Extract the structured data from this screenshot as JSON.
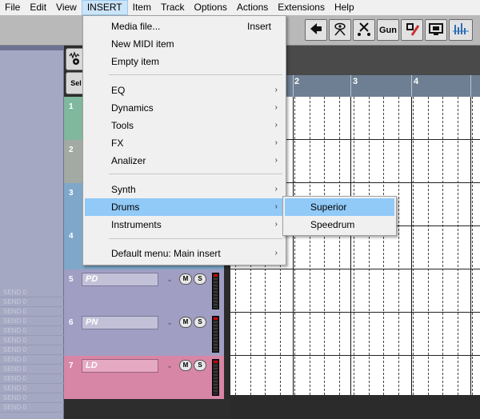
{
  "menubar": {
    "items": [
      "File",
      "Edit",
      "View",
      "INSERT",
      "Item",
      "Track",
      "Options",
      "Actions",
      "Extensions",
      "Help"
    ],
    "active": "INSERT"
  },
  "toolbar": {
    "buttons": [
      {
        "icon": "arrow-left-icon"
      },
      {
        "icon": "eye-icon"
      },
      {
        "icon": "nodes-icon"
      },
      {
        "label": "Gun"
      },
      {
        "icon": "brush-icon"
      },
      {
        "icon": "tape-icon"
      },
      {
        "icon": "meter-icon"
      }
    ],
    "select_label": "Sel"
  },
  "insert_menu": {
    "media_file": "Media file...",
    "media_file_shortcut": "Insert",
    "new_midi": "New MIDI item",
    "empty_item": "Empty item",
    "eq": "EQ",
    "dynamics": "Dynamics",
    "tools": "Tools",
    "fx": "FX",
    "analizer": "Analizer",
    "synth": "Synth",
    "drums": "Drums",
    "instruments": "Instruments",
    "default_menu": "Default menu: Main insert"
  },
  "drums_submenu": {
    "superior": "Superior",
    "speedrum": "Speedrum"
  },
  "tracks": [
    {
      "num": "1",
      "name": "",
      "color": "#7fb89c"
    },
    {
      "num": "2",
      "name": "",
      "color": "#a3aaa3"
    },
    {
      "num": "3",
      "name": "",
      "color": "#7fa7c9"
    },
    {
      "num": "4",
      "name": "",
      "color": "#7fa7c9"
    },
    {
      "num": "5",
      "name": "PD",
      "color": "#a09ec2"
    },
    {
      "num": "6",
      "name": "PN",
      "color": "#a09ec2"
    },
    {
      "num": "7",
      "name": "LD",
      "color": "#d886a6"
    }
  ],
  "track_buttons": {
    "mute": "M",
    "solo": "S"
  },
  "ruler": {
    "markers": [
      "2",
      "3",
      "4"
    ]
  },
  "leftdock": {
    "row_text": "SEND 0"
  }
}
